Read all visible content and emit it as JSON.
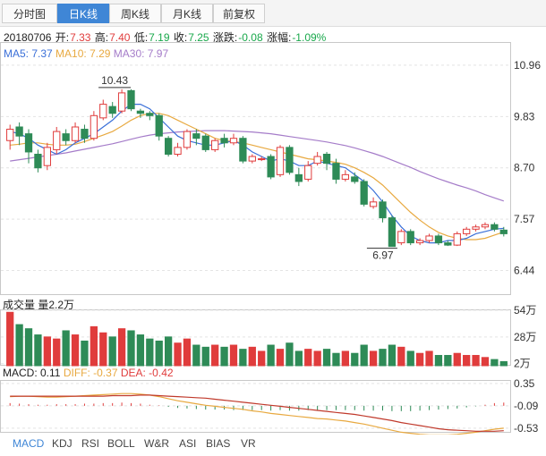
{
  "tabs": [
    "分时图",
    "日K线",
    "周K线",
    "月K线",
    "前复权"
  ],
  "active_tab": 1,
  "ohlc": {
    "date": "20180706",
    "open_label": "开:",
    "open": "7.33",
    "high_label": "高:",
    "high": "7.40",
    "low_label": "低:",
    "low": "7.19",
    "close_label": "收:",
    "close": "7.25",
    "change_label": "涨跌:",
    "change": "-0.08",
    "pct_label": "涨幅:",
    "pct": "-1.09%"
  },
  "ma_legend": {
    "ma5": "MA5: 7.37",
    "ma10": "MA10: 7.29",
    "ma30": "MA30: 7.97"
  },
  "vol_legend": "成交量 量2.2万",
  "macd_legend": {
    "macd": "MACD: 0.11",
    "diff": "DIFF: -0.37",
    "dea": "DEA: -0.42"
  },
  "indicator_tabs": [
    "MACD",
    "KDJ",
    "RSI",
    "BOLL",
    "W&R",
    "ASI",
    "BIAS",
    "VR"
  ],
  "colors": {
    "up": "#e03c3c",
    "down": "#2e8b57",
    "ma5": "#3a6fd8",
    "ma10": "#e8a940",
    "ma30": "#a57cc9",
    "accent": "#3f86d6"
  },
  "chart_data": {
    "type": "candlestick",
    "price_axis": {
      "ticks": [
        10.96,
        9.83,
        8.7,
        7.57,
        6.44
      ],
      "ylim": [
        5.9,
        11.45
      ]
    },
    "volume_axis": {
      "ticks": [
        "54万",
        "28万",
        "2万"
      ],
      "ylim": [
        0,
        54
      ]
    },
    "macd_axis": {
      "ticks": [
        0.35,
        -0.09,
        -0.53
      ],
      "ylim": [
        -0.62,
        0.4
      ]
    },
    "annotations": {
      "high": "10.43",
      "low": "6.97"
    },
    "candles": [
      {
        "o": 9.3,
        "c": 9.55,
        "h": 9.65,
        "l": 9.1
      },
      {
        "o": 9.6,
        "c": 9.4,
        "h": 9.7,
        "l": 9.2
      },
      {
        "o": 9.45,
        "c": 9.05,
        "h": 9.55,
        "l": 8.8
      },
      {
        "o": 9.0,
        "c": 8.7,
        "h": 9.1,
        "l": 8.6
      },
      {
        "o": 8.75,
        "c": 9.15,
        "h": 9.25,
        "l": 8.65
      },
      {
        "o": 9.1,
        "c": 9.5,
        "h": 9.6,
        "l": 9.0
      },
      {
        "o": 9.45,
        "c": 9.3,
        "h": 9.55,
        "l": 9.2
      },
      {
        "o": 9.3,
        "c": 9.6,
        "h": 9.7,
        "l": 9.25
      },
      {
        "o": 9.55,
        "c": 9.35,
        "h": 9.65,
        "l": 9.25
      },
      {
        "o": 9.35,
        "c": 9.85,
        "h": 9.95,
        "l": 9.3
      },
      {
        "o": 9.8,
        "c": 10.1,
        "h": 10.2,
        "l": 9.75
      },
      {
        "o": 10.05,
        "c": 9.9,
        "h": 10.15,
        "l": 9.8
      },
      {
        "o": 9.95,
        "c": 10.35,
        "h": 10.43,
        "l": 9.9
      },
      {
        "o": 10.4,
        "c": 10.0,
        "h": 10.43,
        "l": 9.95
      },
      {
        "o": 9.95,
        "c": 9.9,
        "h": 10.0,
        "l": 9.8
      },
      {
        "o": 9.9,
        "c": 9.85,
        "h": 9.95,
        "l": 9.75
      },
      {
        "o": 9.85,
        "c": 9.4,
        "h": 9.9,
        "l": 9.3
      },
      {
        "o": 9.35,
        "c": 9.0,
        "h": 9.4,
        "l": 8.95
      },
      {
        "o": 9.0,
        "c": 9.15,
        "h": 9.25,
        "l": 8.95
      },
      {
        "o": 9.15,
        "c": 9.5,
        "h": 9.55,
        "l": 9.1
      },
      {
        "o": 9.45,
        "c": 9.35,
        "h": 9.55,
        "l": 9.2
      },
      {
        "o": 9.4,
        "c": 9.1,
        "h": 9.45,
        "l": 9.05
      },
      {
        "o": 9.1,
        "c": 9.3,
        "h": 9.35,
        "l": 9.05
      },
      {
        "o": 9.35,
        "c": 9.25,
        "h": 9.45,
        "l": 9.15
      },
      {
        "o": 9.25,
        "c": 9.35,
        "h": 9.45,
        "l": 9.2
      },
      {
        "o": 9.35,
        "c": 8.85,
        "h": 9.4,
        "l": 8.8
      },
      {
        "o": 8.85,
        "c": 8.95,
        "h": 9.0,
        "l": 8.8
      },
      {
        "o": 8.9,
        "c": 8.9,
        "h": 8.95,
        "l": 8.85
      },
      {
        "o": 8.95,
        "c": 8.5,
        "h": 9.0,
        "l": 8.45
      },
      {
        "o": 8.55,
        "c": 9.15,
        "h": 9.2,
        "l": 8.5
      },
      {
        "o": 9.15,
        "c": 8.6,
        "h": 9.2,
        "l": 8.55
      },
      {
        "o": 8.55,
        "c": 8.4,
        "h": 8.7,
        "l": 8.3
      },
      {
        "o": 8.45,
        "c": 8.75,
        "h": 8.85,
        "l": 8.4
      },
      {
        "o": 8.8,
        "c": 8.95,
        "h": 9.05,
        "l": 8.75
      },
      {
        "o": 9.0,
        "c": 8.8,
        "h": 9.05,
        "l": 8.65
      },
      {
        "o": 8.8,
        "c": 8.45,
        "h": 8.9,
        "l": 8.35
      },
      {
        "o": 8.45,
        "c": 8.55,
        "h": 8.65,
        "l": 8.4
      },
      {
        "o": 8.5,
        "c": 8.4,
        "h": 8.6,
        "l": 8.35
      },
      {
        "o": 8.4,
        "c": 7.9,
        "h": 8.45,
        "l": 7.85
      },
      {
        "o": 7.85,
        "c": 7.95,
        "h": 8.05,
        "l": 7.8
      },
      {
        "o": 7.95,
        "c": 7.6,
        "h": 8.0,
        "l": 7.5
      },
      {
        "o": 7.6,
        "c": 6.97,
        "h": 7.65,
        "l": 6.97
      },
      {
        "o": 7.05,
        "c": 7.3,
        "h": 7.35,
        "l": 7.0
      },
      {
        "o": 7.3,
        "c": 7.05,
        "h": 7.35,
        "l": 7.0
      },
      {
        "o": 7.05,
        "c": 7.1,
        "h": 7.15,
        "l": 7.0
      },
      {
        "o": 7.1,
        "c": 7.2,
        "h": 7.25,
        "l": 7.05
      },
      {
        "o": 7.2,
        "c": 7.05,
        "h": 7.25,
        "l": 7.0
      },
      {
        "o": 7.05,
        "c": 7.0,
        "h": 7.1,
        "l": 6.98
      },
      {
        "o": 7.0,
        "c": 7.25,
        "h": 7.3,
        "l": 6.98
      },
      {
        "o": 7.25,
        "c": 7.35,
        "h": 7.4,
        "l": 7.2
      },
      {
        "o": 7.35,
        "c": 7.4,
        "h": 7.45,
        "l": 7.3
      },
      {
        "o": 7.4,
        "c": 7.45,
        "h": 7.5,
        "l": 7.35
      },
      {
        "o": 7.45,
        "c": 7.35,
        "h": 7.5,
        "l": 7.3
      },
      {
        "o": 7.33,
        "c": 7.25,
        "h": 7.4,
        "l": 7.19
      }
    ],
    "ma5": [
      9.5,
      9.45,
      9.35,
      9.2,
      9.1,
      9.0,
      9.1,
      9.25,
      9.35,
      9.45,
      9.6,
      9.75,
      9.95,
      10.1,
      10.1,
      10.0,
      9.8,
      9.6,
      9.4,
      9.3,
      9.25,
      9.2,
      9.2,
      9.25,
      9.3,
      9.2,
      9.05,
      8.95,
      8.85,
      8.9,
      8.85,
      8.75,
      8.75,
      8.85,
      8.8,
      8.75,
      8.7,
      8.55,
      8.4,
      8.2,
      7.95,
      7.65,
      7.4,
      7.2,
      7.1,
      7.05,
      7.05,
      7.1,
      7.1,
      7.15,
      7.25,
      7.3,
      7.35,
      7.37
    ],
    "ma10": [
      9.2,
      9.22,
      9.25,
      9.25,
      9.22,
      9.2,
      9.2,
      9.22,
      9.28,
      9.35,
      9.42,
      9.5,
      9.62,
      9.75,
      9.85,
      9.9,
      9.9,
      9.85,
      9.75,
      9.65,
      9.55,
      9.45,
      9.35,
      9.3,
      9.28,
      9.25,
      9.2,
      9.15,
      9.1,
      9.05,
      9.0,
      8.95,
      8.9,
      8.88,
      8.85,
      8.82,
      8.78,
      8.7,
      8.6,
      8.48,
      8.32,
      8.12,
      7.92,
      7.72,
      7.55,
      7.4,
      7.28,
      7.2,
      7.15,
      7.12,
      7.12,
      7.15,
      7.22,
      7.29
    ],
    "ma30": [
      8.85,
      8.88,
      8.91,
      8.94,
      8.97,
      9.0,
      9.03,
      9.07,
      9.11,
      9.15,
      9.19,
      9.23,
      9.28,
      9.33,
      9.38,
      9.42,
      9.45,
      9.47,
      9.49,
      9.5,
      9.51,
      9.52,
      9.52,
      9.52,
      9.51,
      9.5,
      9.49,
      9.47,
      9.45,
      9.42,
      9.39,
      9.36,
      9.33,
      9.3,
      9.27,
      9.23,
      9.19,
      9.14,
      9.08,
      9.02,
      8.95,
      8.87,
      8.79,
      8.71,
      8.62,
      8.54,
      8.46,
      8.39,
      8.32,
      8.26,
      8.19,
      8.11,
      8.04,
      7.97
    ],
    "volume": [
      52,
      40,
      36,
      30,
      28,
      26,
      34,
      30,
      24,
      38,
      32,
      28,
      36,
      34,
      30,
      26,
      24,
      28,
      22,
      26,
      20,
      18,
      20,
      18,
      20,
      16,
      18,
      14,
      20,
      16,
      22,
      14,
      16,
      14,
      16,
      12,
      14,
      12,
      20,
      14,
      16,
      20,
      18,
      14,
      12,
      14,
      10,
      10,
      12,
      10,
      10,
      8,
      6,
      4
    ],
    "macd_hist": [
      0.05,
      0.04,
      0.03,
      0.02,
      0.02,
      0.03,
      0.03,
      0.03,
      0.04,
      0.04,
      0.05,
      0.05,
      0.06,
      0.05,
      0.04,
      0.02,
      0.01,
      -0.02,
      -0.04,
      -0.05,
      -0.06,
      -0.07,
      -0.07,
      -0.07,
      -0.08,
      -0.08,
      -0.08,
      -0.08,
      -0.09,
      -0.08,
      -0.09,
      -0.09,
      -0.08,
      -0.08,
      -0.08,
      -0.08,
      -0.08,
      -0.08,
      -0.09,
      -0.09,
      -0.09,
      -0.1,
      -0.1,
      -0.1,
      -0.09,
      -0.08,
      -0.07,
      -0.06,
      -0.05,
      -0.03,
      -0.01,
      0.02,
      0.05,
      0.06
    ],
    "diff": [
      0.25,
      0.26,
      0.26,
      0.25,
      0.24,
      0.24,
      0.25,
      0.26,
      0.27,
      0.28,
      0.29,
      0.3,
      0.31,
      0.31,
      0.3,
      0.28,
      0.25,
      0.21,
      0.17,
      0.14,
      0.11,
      0.08,
      0.06,
      0.04,
      0.02,
      0.0,
      -0.03,
      -0.05,
      -0.08,
      -0.1,
      -0.12,
      -0.14,
      -0.16,
      -0.18,
      -0.19,
      -0.21,
      -0.23,
      -0.26,
      -0.29,
      -0.33,
      -0.37,
      -0.41,
      -0.45,
      -0.47,
      -0.49,
      -0.5,
      -0.5,
      -0.5,
      -0.49,
      -0.47,
      -0.45,
      -0.42,
      -0.39,
      -0.37
    ],
    "dea": [
      0.26,
      0.26,
      0.26,
      0.26,
      0.26,
      0.26,
      0.26,
      0.26,
      0.26,
      0.26,
      0.26,
      0.27,
      0.27,
      0.27,
      0.28,
      0.28,
      0.27,
      0.26,
      0.25,
      0.24,
      0.23,
      0.22,
      0.2,
      0.18,
      0.16,
      0.14,
      0.12,
      0.1,
      0.08,
      0.06,
      0.04,
      0.02,
      0.0,
      -0.02,
      -0.04,
      -0.06,
      -0.08,
      -0.1,
      -0.13,
      -0.16,
      -0.19,
      -0.22,
      -0.26,
      -0.29,
      -0.32,
      -0.35,
      -0.38,
      -0.4,
      -0.41,
      -0.42,
      -0.43,
      -0.43,
      -0.43,
      -0.42
    ]
  }
}
